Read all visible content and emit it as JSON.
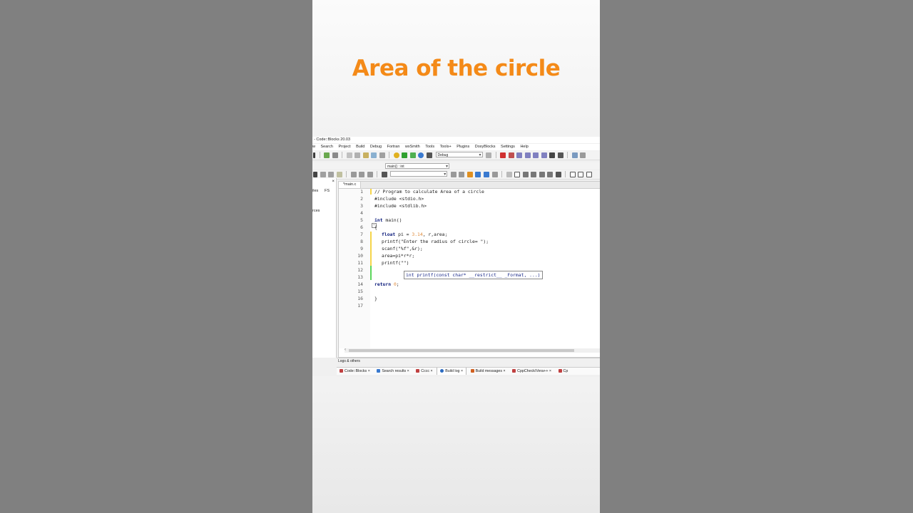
{
  "headline": "Area of the circle",
  "app": {
    "title": "- Code::Blocks 20.03",
    "menu": [
      "w",
      "Search",
      "Project",
      "Build",
      "Debug",
      "Fortran",
      "wxSmith",
      "Tools",
      "Tools+",
      "Plugins",
      "DoxyBlocks",
      "Settings",
      "Help"
    ],
    "build_target": "Debug",
    "scope": "main() : int",
    "left_panel": {
      "tab_files": "iles",
      "tab_fs": "FS",
      "item": "rces"
    },
    "editor_tab": "*main.c",
    "line_numbers": [
      "1",
      "2",
      "3",
      "4",
      "5",
      "6",
      "7",
      "8",
      "9",
      "10",
      "11",
      "12",
      "13",
      "14",
      "15",
      "16",
      "17"
    ],
    "code": {
      "l1": "// Program to calculate Area of a circle",
      "l2": "#include <stdio.h>",
      "l3": "#include <stdlib.h>",
      "l5_kw": "int",
      "l5_rest": " main()",
      "l6": "{",
      "l7_kw": "float",
      "l7_a": " pi = ",
      "l7_num": "3.14",
      "l7_b": ", r,area;",
      "l8": "printf(\"Enter the radius of circle= \");",
      "l9": "scanf(\"%f\",&r);",
      "l10": "area=pi*r*r;",
      "l11": "printf(\"\")",
      "l14_kw": "return",
      "l14_num": " 0",
      "l14_end": ";",
      "l16": "}"
    },
    "tooltip": "int printf(const char* __restrict__ _Format, ...)",
    "logs_header": "Logs & others",
    "log_tabs": [
      "Code::Blocks",
      "Search results",
      "Cccc",
      "Build log",
      "Build messages",
      "CppCheck/Vera++",
      "Cp"
    ],
    "active_log_tab": "Build log",
    "colors": {
      "headline": "#f48a18",
      "keyword": "#0a1a7a",
      "comment": "#9aa3b5",
      "preprocessor": "#2aa02a",
      "number": "#e08a3a"
    }
  }
}
